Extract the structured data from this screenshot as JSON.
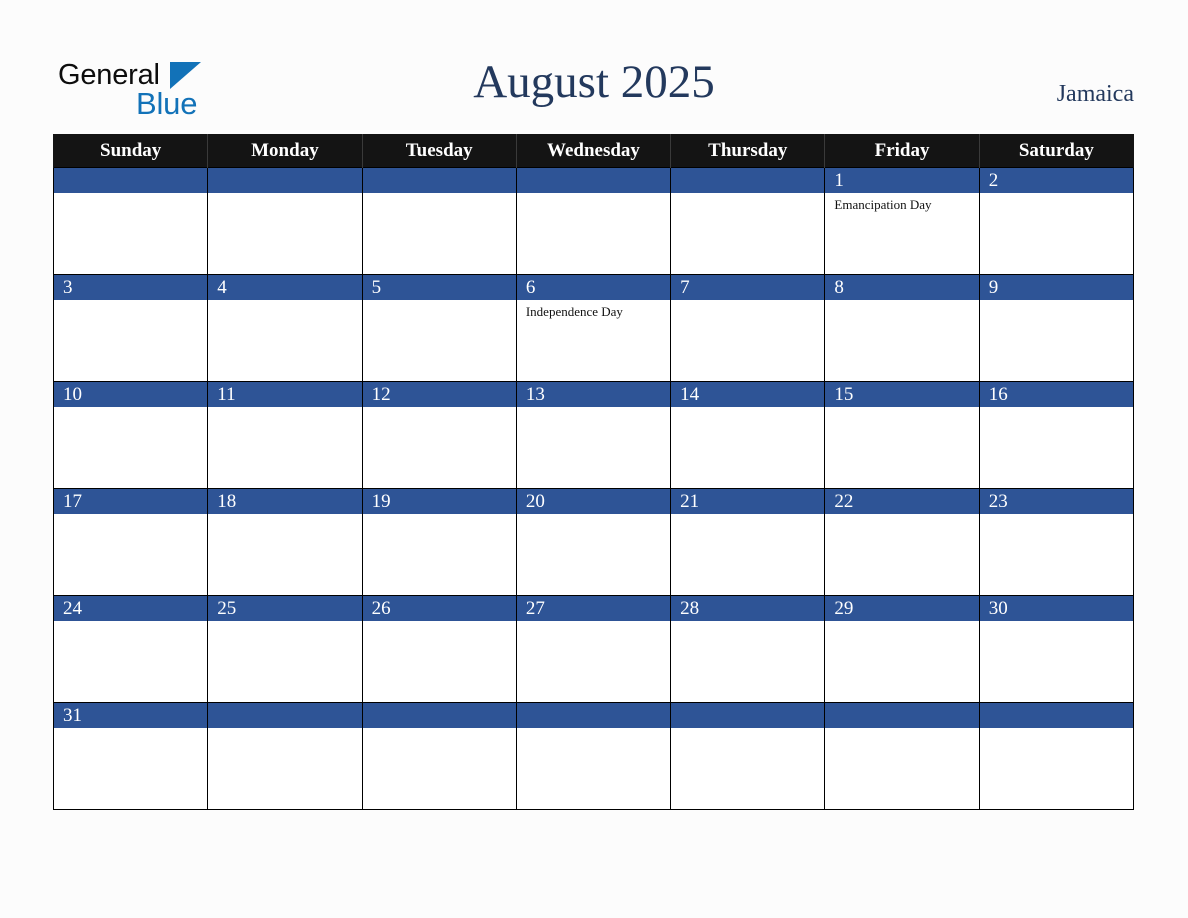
{
  "brand": {
    "name_part1": "General",
    "name_part2": "Blue",
    "triangle_color": "#1272b8",
    "text_color": "#0d0d0d"
  },
  "header": {
    "title": "August 2025",
    "country": "Jamaica",
    "title_color": "#23395d"
  },
  "calendar": {
    "weekdays": [
      "Sunday",
      "Monday",
      "Tuesday",
      "Wednesday",
      "Thursday",
      "Friday",
      "Saturday"
    ],
    "header_bg": "#141414",
    "day_band_color": "#2e5496",
    "weeks": [
      [
        {
          "day": "",
          "event": ""
        },
        {
          "day": "",
          "event": ""
        },
        {
          "day": "",
          "event": ""
        },
        {
          "day": "",
          "event": ""
        },
        {
          "day": "",
          "event": ""
        },
        {
          "day": "1",
          "event": "Emancipation Day"
        },
        {
          "day": "2",
          "event": ""
        }
      ],
      [
        {
          "day": "3",
          "event": ""
        },
        {
          "day": "4",
          "event": ""
        },
        {
          "day": "5",
          "event": ""
        },
        {
          "day": "6",
          "event": "Independence Day"
        },
        {
          "day": "7",
          "event": ""
        },
        {
          "day": "8",
          "event": ""
        },
        {
          "day": "9",
          "event": ""
        }
      ],
      [
        {
          "day": "10",
          "event": ""
        },
        {
          "day": "11",
          "event": ""
        },
        {
          "day": "12",
          "event": ""
        },
        {
          "day": "13",
          "event": ""
        },
        {
          "day": "14",
          "event": ""
        },
        {
          "day": "15",
          "event": ""
        },
        {
          "day": "16",
          "event": ""
        }
      ],
      [
        {
          "day": "17",
          "event": ""
        },
        {
          "day": "18",
          "event": ""
        },
        {
          "day": "19",
          "event": ""
        },
        {
          "day": "20",
          "event": ""
        },
        {
          "day": "21",
          "event": ""
        },
        {
          "day": "22",
          "event": ""
        },
        {
          "day": "23",
          "event": ""
        }
      ],
      [
        {
          "day": "24",
          "event": ""
        },
        {
          "day": "25",
          "event": ""
        },
        {
          "day": "26",
          "event": ""
        },
        {
          "day": "27",
          "event": ""
        },
        {
          "day": "28",
          "event": ""
        },
        {
          "day": "29",
          "event": ""
        },
        {
          "day": "30",
          "event": ""
        }
      ],
      [
        {
          "day": "31",
          "event": ""
        },
        {
          "day": "",
          "event": ""
        },
        {
          "day": "",
          "event": ""
        },
        {
          "day": "",
          "event": ""
        },
        {
          "day": "",
          "event": ""
        },
        {
          "day": "",
          "event": ""
        },
        {
          "day": "",
          "event": ""
        }
      ]
    ]
  }
}
